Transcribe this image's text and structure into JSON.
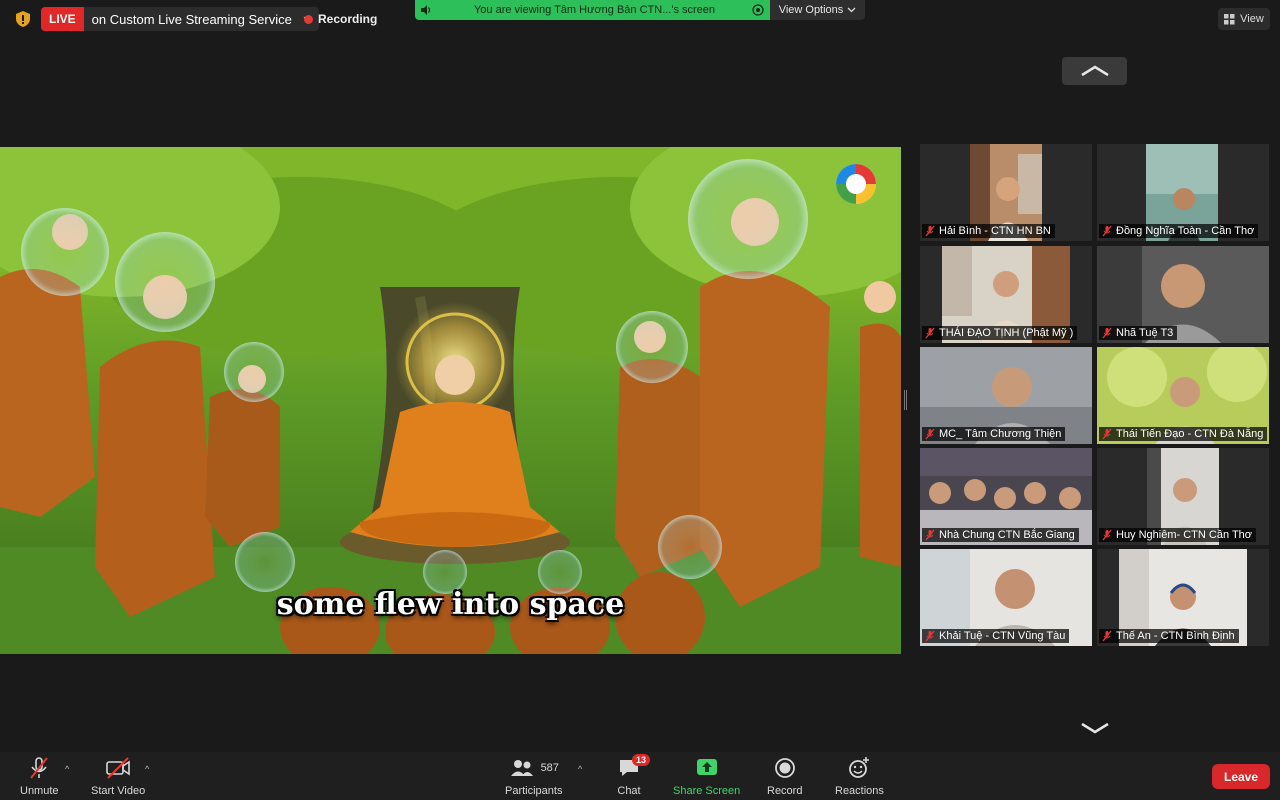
{
  "topbar": {
    "live_badge": "LIVE",
    "live_service": "on Custom Live Streaming Service",
    "recording_label": "Recording",
    "viewing_text": "You are viewing Tâm Hương Bản CTN...'s screen",
    "view_options_label": "View Options",
    "view_label": "View"
  },
  "shared_screen": {
    "subtitle": "some flew into space"
  },
  "gallery": {
    "participants": [
      {
        "name": "Hải Bình - CTN HN BN",
        "muted": true,
        "active": false
      },
      {
        "name": "Đồng Nghĩa Toàn - Cần Thơ",
        "muted": true,
        "active": false
      },
      {
        "name": "THÁI ĐẠO TỊNH (Phật Mỹ )",
        "muted": true,
        "active": false
      },
      {
        "name": "Nhã Tuệ T3",
        "muted": true,
        "active": false
      },
      {
        "name": "MC_ Tâm Chương Thiện",
        "muted": true,
        "active": true
      },
      {
        "name": "Thái Tiến Đạo - CTN Đà Nẵng",
        "muted": true,
        "active": false
      },
      {
        "name": "Nhà Chung CTN Bắc Giang",
        "muted": true,
        "active": false
      },
      {
        "name": "Huy Nghiêm- CTN Cần Thơ",
        "muted": true,
        "active": false
      },
      {
        "name": "Khải Tuệ - CTN Vũng Tàu",
        "muted": true,
        "active": false
      },
      {
        "name": "Thế An - CTN Bình Định",
        "muted": true,
        "active": false
      }
    ]
  },
  "toolbar": {
    "unmute_label": "Unmute",
    "start_video_label": "Start Video",
    "participants_count": "587",
    "participants_label": "Participants",
    "chat_badge": "13",
    "chat_label": "Chat",
    "share_screen_label": "Share Screen",
    "record_label": "Record",
    "reactions_label": "Reactions",
    "leave_label": "Leave"
  },
  "colors": {
    "live_red": "#e02828",
    "banner_green": "#2dbf5a",
    "share_green": "#3fd46b",
    "active_speaker_outline": "#d8e97a",
    "leave_red": "#d9282b"
  },
  "icons": [
    "shield-icon",
    "speaker-icon",
    "chevron-down-icon",
    "grid-view-icon",
    "chevron-up-icon",
    "muted-mic-icon",
    "video-off-icon",
    "participants-icon",
    "chat-icon",
    "share-screen-icon",
    "record-icon",
    "reactions-icon"
  ]
}
